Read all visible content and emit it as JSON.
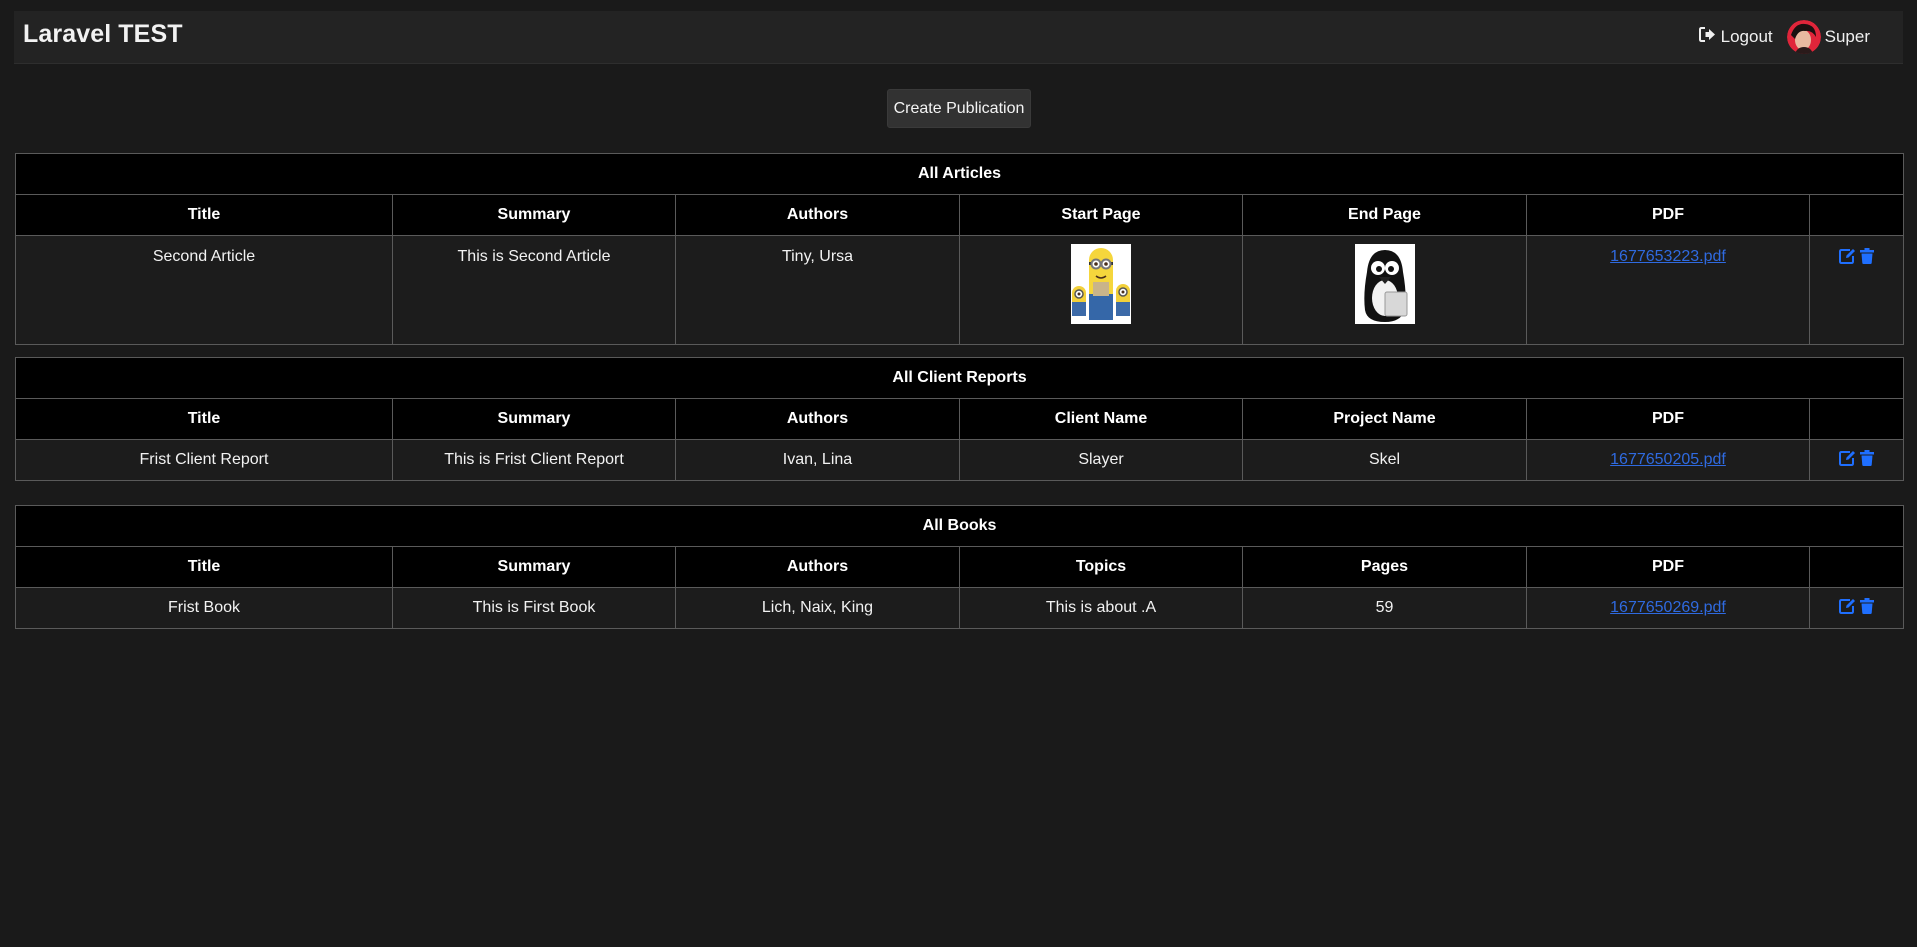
{
  "app": {
    "brand": "Laravel TEST",
    "logout_label": "Logout",
    "user_name": "Super",
    "create_button_label": "Create Publication"
  },
  "colors": {
    "background": "#1a1a1a",
    "navbar": "#232323",
    "table_header": "#000000",
    "link": "#2f6ae0",
    "action_icon": "#1f6fff"
  },
  "articles": {
    "caption": "All Articles",
    "columns": [
      "Title",
      "Summary",
      "Authors",
      "Start Page",
      "End Page",
      "PDF",
      ""
    ],
    "rows": [
      {
        "title": "Second Article",
        "summary": "This is Second Article",
        "authors": "Tiny, Ursa",
        "start_page_image": "minions-image",
        "end_page_image": "penguin-image",
        "pdf": "1677653223.pdf"
      }
    ]
  },
  "client_reports": {
    "caption": "All Client Reports",
    "columns": [
      "Title",
      "Summary",
      "Authors",
      "Client Name",
      "Project Name",
      "PDF",
      ""
    ],
    "rows": [
      {
        "title": "Frist Client Report",
        "summary": "This is Frist Client Report",
        "authors": "Ivan, Lina",
        "client_name": "Slayer",
        "project_name": "Skel",
        "pdf": "1677650205.pdf"
      }
    ]
  },
  "books": {
    "caption": "All Books",
    "columns": [
      "Title",
      "Summary",
      "Authors",
      "Topics",
      "Pages",
      "PDF",
      ""
    ],
    "rows": [
      {
        "title": "Frist Book",
        "summary": "This is First Book",
        "authors": "Lich, Naix, King",
        "topics": "This is about .A",
        "pages": "59",
        "pdf": "1677650269.pdf"
      }
    ]
  },
  "icons": {
    "logout": "sign-out-icon",
    "edit": "edit-icon",
    "delete": "trash-icon"
  }
}
